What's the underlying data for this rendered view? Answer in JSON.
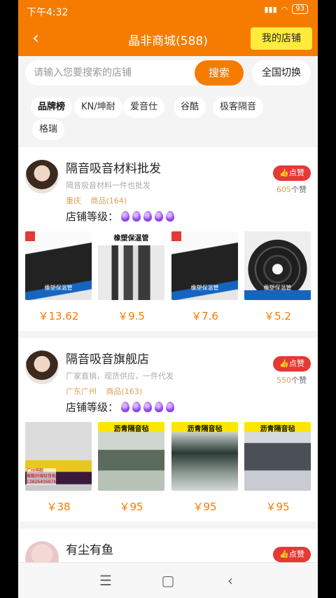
{
  "status": {
    "time": "下午4:32",
    "battery": "93"
  },
  "header": {
    "title": "晶非商城(588)",
    "my_store": "我的店铺"
  },
  "search": {
    "placeholder": "请输入您要搜索的店铺",
    "button": "搜索",
    "region_button": "全国切换"
  },
  "brands": [
    "品牌榜",
    "KN/坤耐",
    "爱音仕",
    "谷酷",
    "极客隔音",
    "格瑞"
  ],
  "shops": [
    {
      "name": "隔音吸音材料批发",
      "desc": "隔音吸音材料一件也批发",
      "location": "重庆",
      "products_label": "商品(164)",
      "like_label": "点赞",
      "likes": "605",
      "likes_unit": "个赞",
      "level_label": "店铺等级：",
      "level": 5,
      "products": [
        {
          "price": "￥13.62",
          "img_text": "橡塑保温管"
        },
        {
          "price": "￥9.5",
          "img_text": "橡塑保温管"
        },
        {
          "price": "￥7.6",
          "img_text": "橡塑保温管"
        },
        {
          "price": "￥5.2",
          "img_text": "橡塑保温管"
        }
      ]
    },
    {
      "name": "隔音吸音旗舰店",
      "desc": "厂家直销，现货供应，一件代发",
      "location": "广东广州",
      "products_label": "商品(163)",
      "like_label": "点赞",
      "likes": "550",
      "likes_unit": "个赞",
      "level_label": "店铺等级：",
      "level": 5,
      "products": [
        {
          "price": "￥38",
          "img_text": "广州坤耐\n聚酯纤维吸音板\n13826406974"
        },
        {
          "price": "￥95",
          "img_text": "沥青隔音毡"
        },
        {
          "price": "￥95",
          "img_text": "沥青隔音毡"
        },
        {
          "price": "￥95",
          "img_text": "沥青隔音毡"
        }
      ]
    },
    {
      "name": "有尘有鱼",
      "like_label": "点赞"
    }
  ]
}
